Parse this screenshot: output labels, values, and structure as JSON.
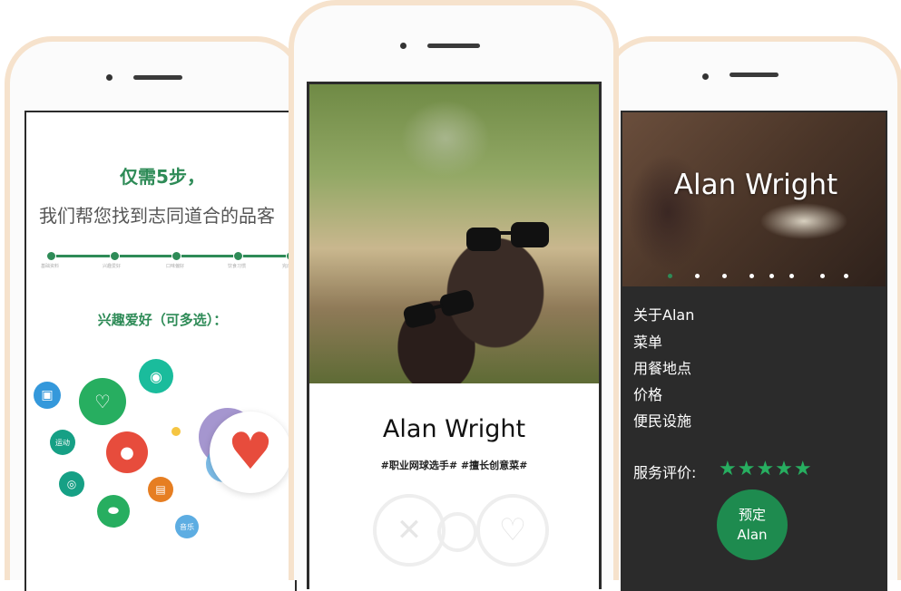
{
  "left_screen": {
    "title": "仅需5步，",
    "subtitle": "我们帮您找到志同道合的品客",
    "steps": [
      "基础资料",
      "兴趣爱好",
      "口味偏好",
      "饮食习惯",
      "完成"
    ],
    "interest_title": "兴趣爱好（可多选）：",
    "bubbles": [
      {
        "icon": "chat-icon",
        "color": "#3498db"
      },
      {
        "icon": "heart-card-icon",
        "color": "#27ae60"
      },
      {
        "icon": "record-player-icon",
        "color": "#1abc9c"
      },
      {
        "label": "运动",
        "color": "#16a085"
      },
      {
        "icon": "ball-icon",
        "color": "#e74c3c"
      },
      {
        "icon": "camera-icon",
        "color": "#16a085"
      },
      {
        "icon": "bag-icon",
        "color": "#e67e22"
      },
      {
        "icon": "football-icon",
        "color": "#27ae60"
      },
      {
        "label": "音乐",
        "color": "#5dade2"
      }
    ],
    "selected_icon": "heart-icon"
  },
  "mid_screen": {
    "name": "Alan Wright",
    "tags": "#职业网球选手# #擅长创意菜#",
    "dislike_icon": "close-icon",
    "like_icon": "heart-outline-icon"
  },
  "right_screen": {
    "name": "Alan Wright",
    "menu": [
      "关于Alan",
      "菜单",
      "用餐地点",
      "价格",
      "便民设施"
    ],
    "rating_label": "服务评价:",
    "stars": "★★★★★",
    "rating": 5,
    "book_line1": "预定",
    "book_line2": "Alan",
    "accent": "#1e8b4f"
  }
}
